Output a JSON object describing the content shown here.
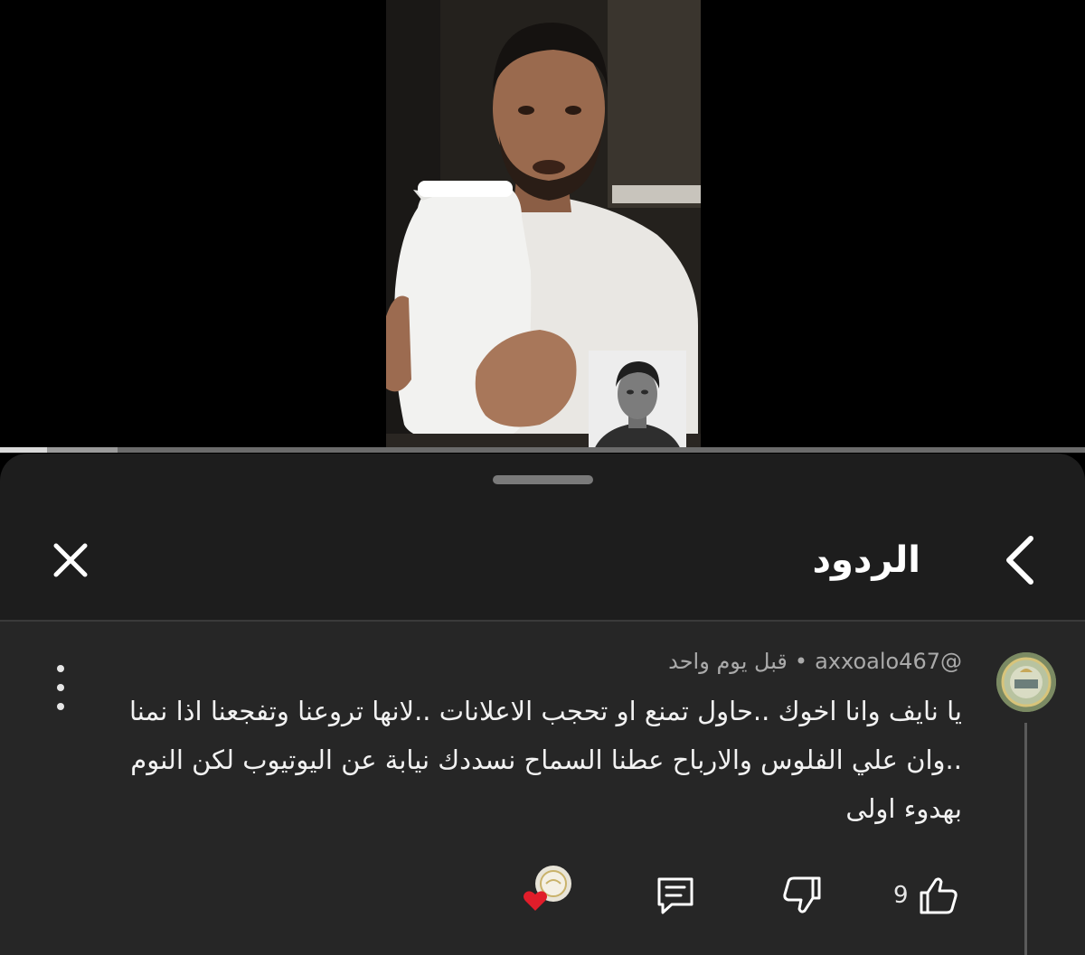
{
  "video": {
    "progress_fraction": 0.043
  },
  "sheet": {
    "title": "الردود"
  },
  "comment": {
    "author": "@axxoalo467",
    "separator": "•",
    "time": "قبل يوم واحد",
    "text": "يا نايف وانا اخوك ..حاول تمنع او تحجب الاعلانات ..لانها تروعنا وتفجعنا اذا نمنا ..وان علي الفلوس والارباح عطنا السماح نسددك نيابة عن اليوتيوب لكن النوم بهدوء اولى",
    "like_count": "9"
  },
  "colors": {
    "sheet_bg": "#1d1d1d",
    "comment_bg": "#262626",
    "heart": "#e11d2a",
    "meta_text": "#aaaaaa"
  },
  "icons": [
    "back-chevron-icon",
    "close-icon",
    "more-vert-icon",
    "like-icon",
    "dislike-icon",
    "reply-icon",
    "creator-heart-icon"
  ]
}
